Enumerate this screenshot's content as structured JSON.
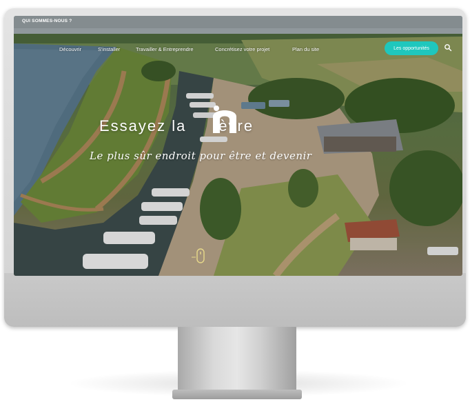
{
  "topbar": {
    "label": "QUI SOMMES-NOUS ?"
  },
  "nav": {
    "items": [
      {
        "label": "Découvrir"
      },
      {
        "label": "S'installer"
      },
      {
        "label": "Travailler & Entreprendre"
      },
      {
        "label": "Concrétisez votre projet"
      },
      {
        "label": "Plan du site"
      }
    ],
    "cta_label": "Les opportunités"
  },
  "hero": {
    "title_part1": "Essayez la",
    "title_part2": "ièvre",
    "subtitle": "Le plus sûr endroit pour être et devenir"
  },
  "icons": {
    "search": "search-icon",
    "logo_letter": "n-logo-icon",
    "scroll": "scroll-down-icon"
  },
  "colors": {
    "accent": "#1fc7bd",
    "text_on_image": "#ffffff"
  }
}
